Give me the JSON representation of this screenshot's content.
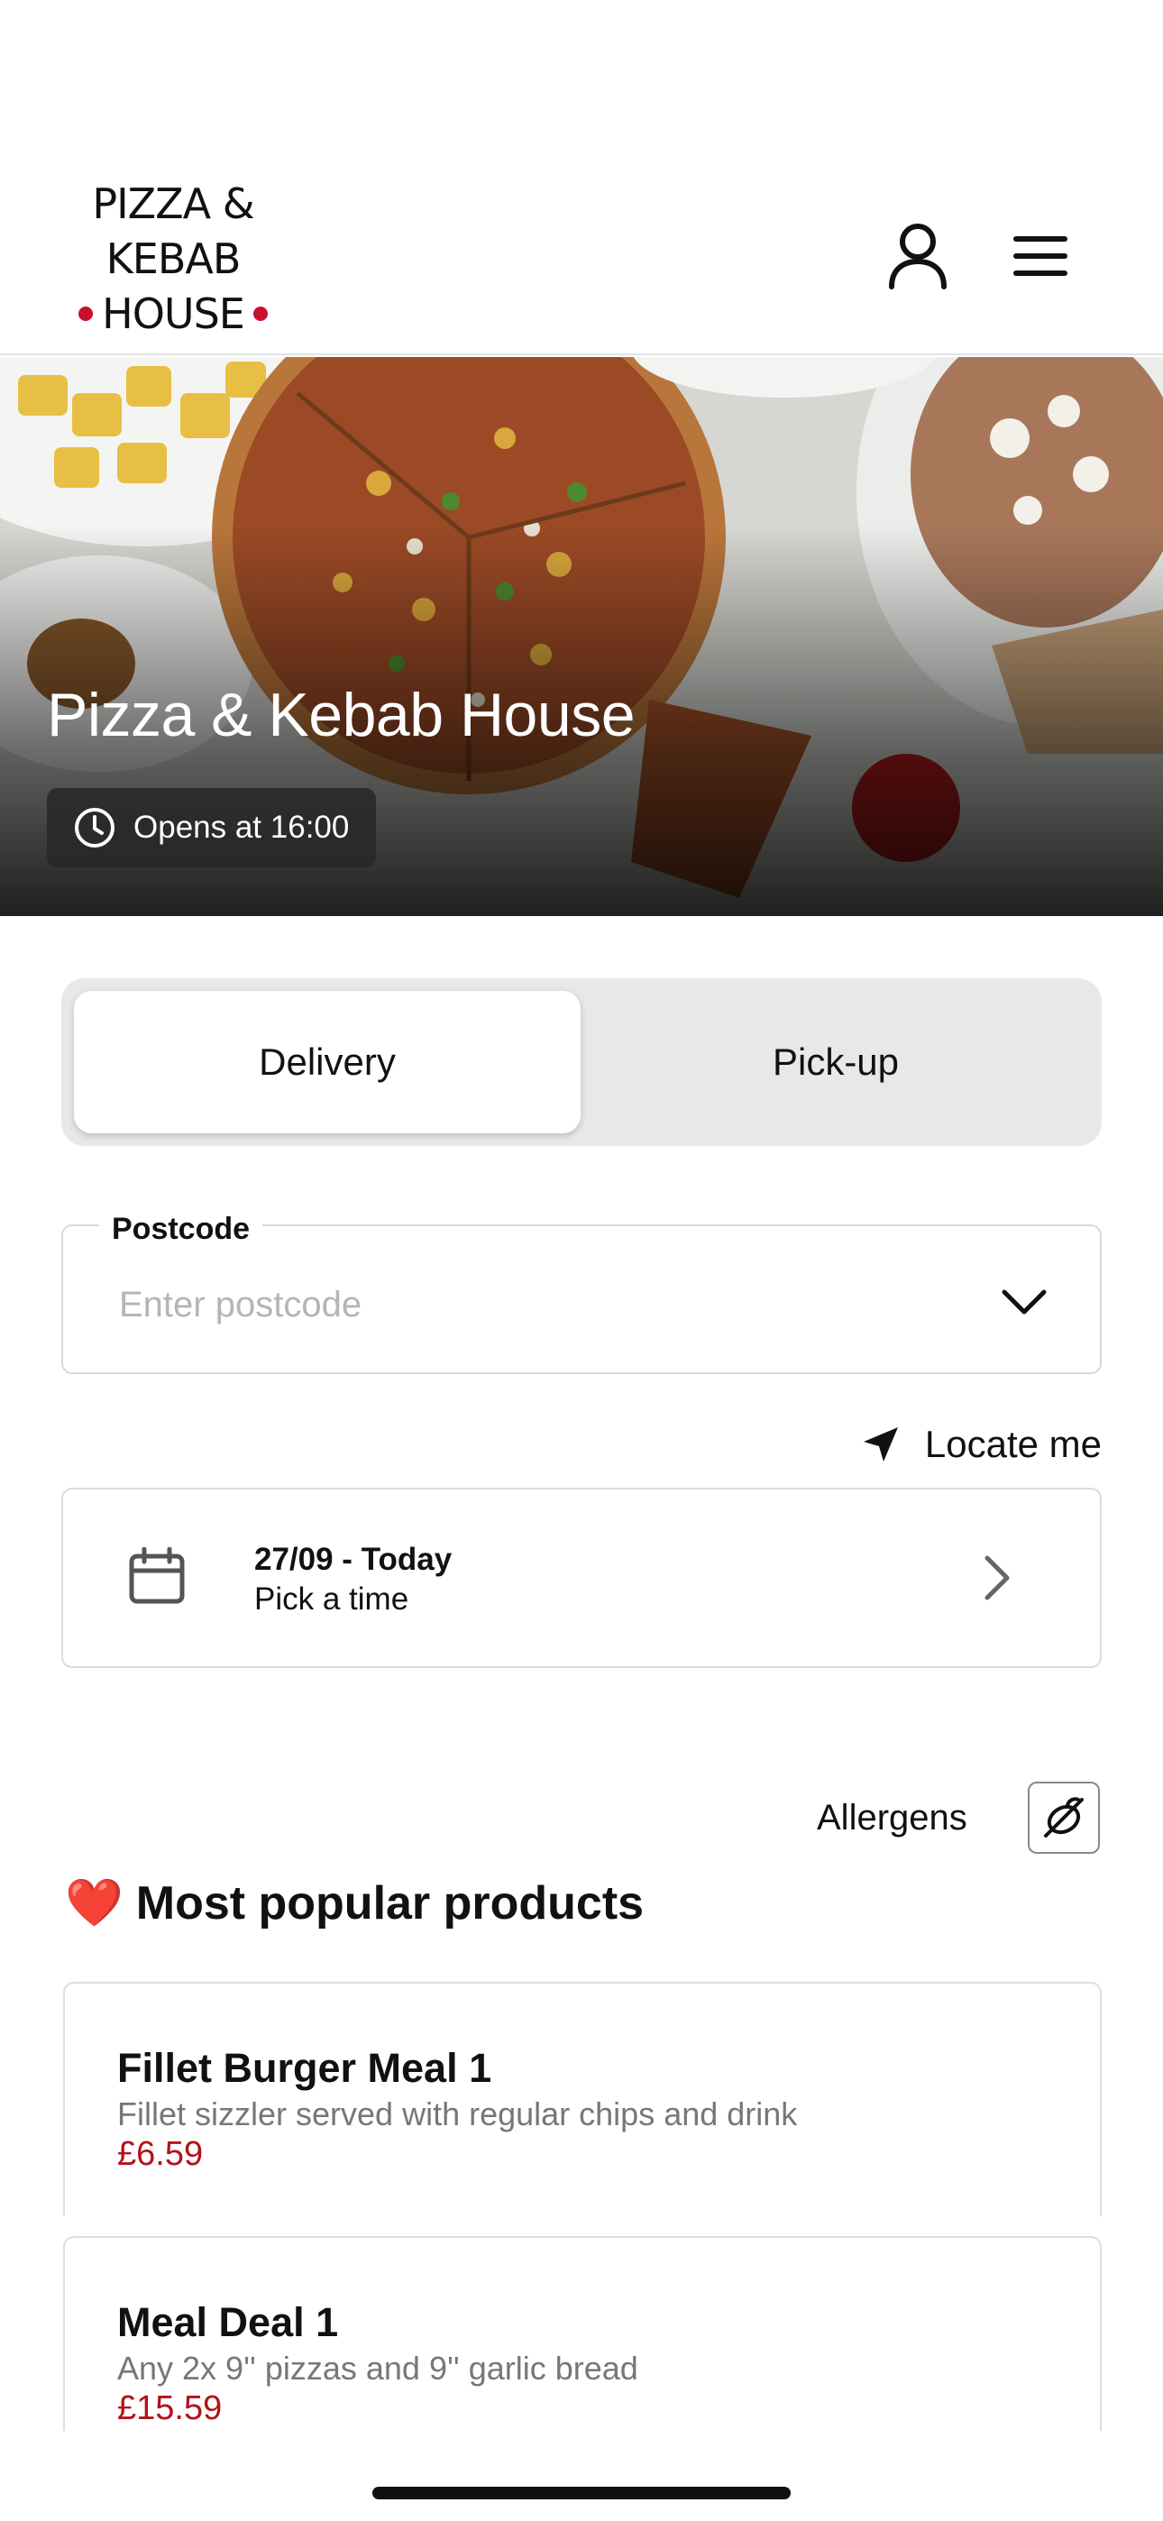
{
  "header": {
    "logo_line1": "PIZZA &",
    "logo_line2": "KEBAB",
    "logo_line3": "HOUSE",
    "account_icon": "user-icon",
    "menu_icon": "hamburger-icon"
  },
  "hero": {
    "title": "Pizza & Kebab House",
    "hours": "Opens at 16:00",
    "hours_icon": "clock-icon"
  },
  "fulfilment": {
    "options": [
      "Delivery",
      "Pick-up"
    ],
    "selected": "Delivery"
  },
  "postcode": {
    "label": "Postcode",
    "placeholder": "Enter postcode",
    "value": ""
  },
  "locate": {
    "label": "Locate me",
    "icon": "location-arrow-icon"
  },
  "schedule": {
    "date": "27/09 - Today",
    "time": "Pick a time",
    "icon": "calendar-icon"
  },
  "allergens": {
    "label": "Allergens",
    "icon": "allergen-filter-icon"
  },
  "popular": {
    "emoji": "❤️",
    "title": "Most popular products",
    "products": [
      {
        "name": "Fillet Burger Meal 1",
        "description": "Fillet sizzler served with regular chips and drink",
        "price": "£6.59"
      },
      {
        "name": "Meal Deal 1",
        "description": "Any 2x 9'' pizzas and 9'' garlic bread",
        "price": "£15.59"
      }
    ]
  },
  "colors": {
    "brand_red": "#c8102e",
    "price_red": "#b3121b",
    "toggle_bg": "#e8e8e8"
  }
}
